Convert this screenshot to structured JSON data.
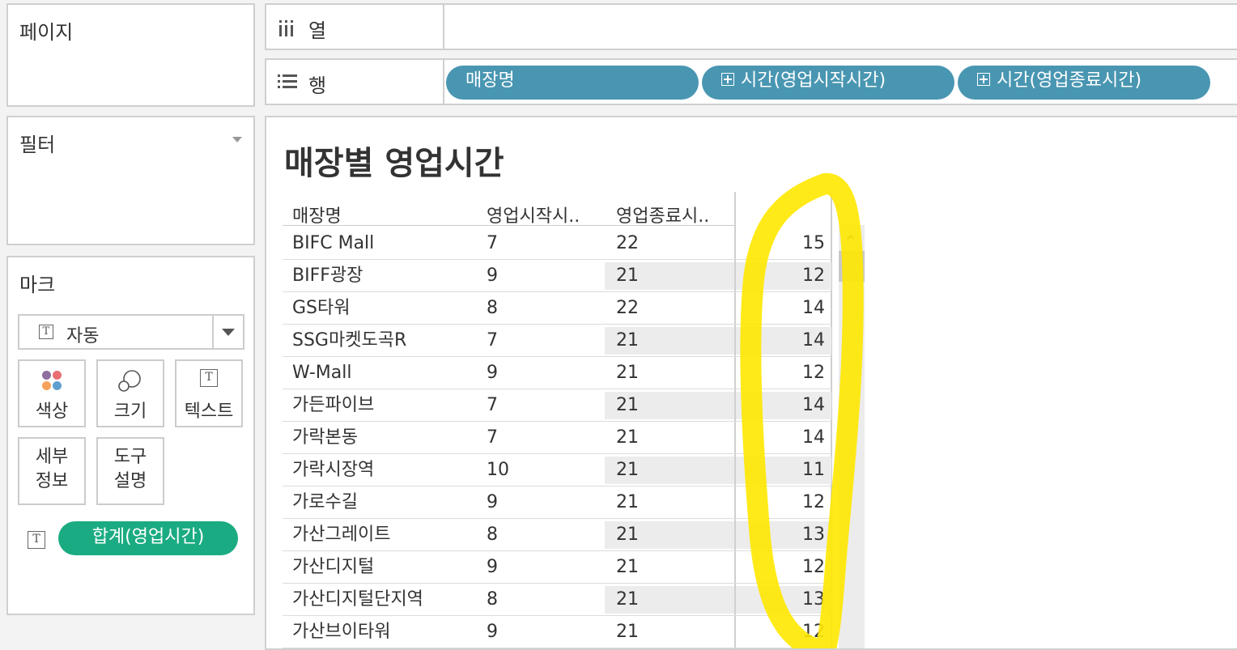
{
  "pages_panel": {
    "title": "페이지"
  },
  "filters_panel": {
    "title": "필터"
  },
  "marks_panel": {
    "title": "마크",
    "mark_type": "자동",
    "buttons": {
      "color": "색상",
      "size": "크기",
      "text": "텍스트",
      "detail_l1": "세부",
      "detail_l2": "정보",
      "tooltip_l1": "도구",
      "tooltip_l2": "설명"
    },
    "measure_pill": "합계(영업시간)",
    "colors": {
      "pill": "#1bab82"
    }
  },
  "shelves": {
    "columns_label": "열",
    "rows_label": "행",
    "row_pills": [
      "매장명",
      "시간(영업시작시간)",
      "시간(영업종료시간)"
    ],
    "pill_color": "#4996b2"
  },
  "view": {
    "title": "매장별 영업시간",
    "headers": [
      "매장명",
      "영업시작시..",
      "영업종료시.."
    ],
    "rows": [
      [
        "BIFC Mall",
        "7",
        "22",
        "15"
      ],
      [
        "BIFF광장",
        "9",
        "21",
        "12"
      ],
      [
        "GS타워",
        "8",
        "22",
        "14"
      ],
      [
        "SSG마켓도곡R",
        "7",
        "21",
        "14"
      ],
      [
        "W-Mall",
        "9",
        "21",
        "12"
      ],
      [
        "가든파이브",
        "7",
        "21",
        "14"
      ],
      [
        "가락본동",
        "7",
        "21",
        "14"
      ],
      [
        "가락시장역",
        "10",
        "21",
        "11"
      ],
      [
        "가로수길",
        "9",
        "21",
        "12"
      ],
      [
        "가산그레이트",
        "8",
        "21",
        "13"
      ],
      [
        "가산디지털",
        "9",
        "21",
        "12"
      ],
      [
        "가산디지털단지역",
        "8",
        "21",
        "13"
      ],
      [
        "가산브이타워",
        "9",
        "21",
        "12"
      ]
    ],
    "highlight_color": "#ffe800"
  }
}
